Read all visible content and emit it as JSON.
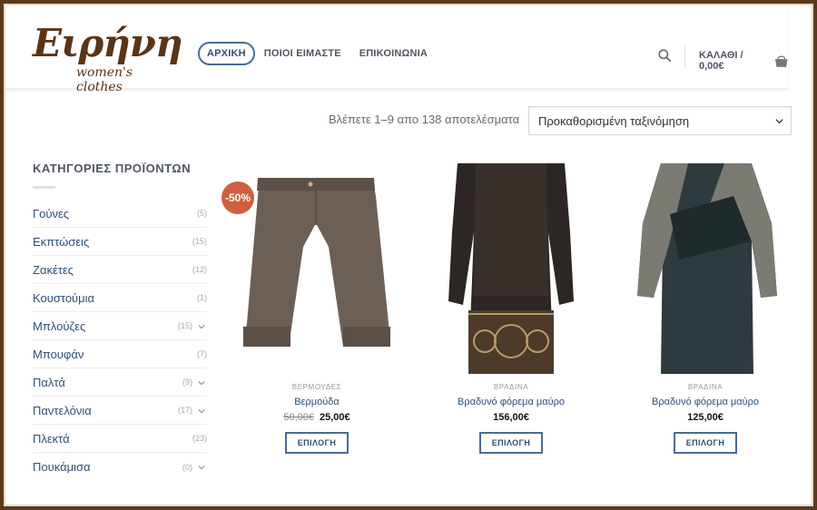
{
  "brand": {
    "name": "Ειρήνη",
    "tagline": "women's clothes"
  },
  "nav": {
    "items": [
      "ΑΡΧΙΚΗ",
      "ΠΟΙΟΙ ΕΙΜΑΣΤΕ",
      "ΕΠΙΚΟΙΝΩΝΙΑ"
    ],
    "active_index": 0
  },
  "cart": {
    "label": "ΚΑΛΑΘΙ / 0,00€"
  },
  "results": {
    "text": "Βλέπετε 1–9 απο 138 αποτελέσματα"
  },
  "sort": {
    "selected": "Προκαθορισμένη ταξινόμηση"
  },
  "sidebar": {
    "title": "ΚΑΤΗΓΟΡΙΕΣ ΠΡΟΪΟΝΤΩΝ",
    "categories": [
      {
        "name": "Γούνες",
        "count": "(5)",
        "expandable": false
      },
      {
        "name": "Εκπτώσεις",
        "count": "(15)",
        "expandable": false
      },
      {
        "name": "Ζακέτες",
        "count": "(12)",
        "expandable": false
      },
      {
        "name": "Κουστούμια",
        "count": "(1)",
        "expandable": false
      },
      {
        "name": "Μπλούζες",
        "count": "(15)",
        "expandable": true
      },
      {
        "name": "Μπουφάν",
        "count": "(7)",
        "expandable": false
      },
      {
        "name": "Παλτά",
        "count": "(9)",
        "expandable": true
      },
      {
        "name": "Παντελόνια",
        "count": "(17)",
        "expandable": true
      },
      {
        "name": "Πλεκτά",
        "count": "(23)",
        "expandable": false
      },
      {
        "name": "Πουκάμισα",
        "count": "(0)",
        "expandable": true
      }
    ]
  },
  "products": [
    {
      "category": "ΒΕΡΜΟΥΔΕΣ",
      "name": "Βερμούδα",
      "old_price": "50,00€",
      "price": "25,00€",
      "badge": "-50%",
      "button": "ΕΠΙΛΟΓΗ"
    },
    {
      "category": "ΒΡΑΔΙΝΑ",
      "name": "Βραδυνό φόρεμα μαύρο",
      "old_price": "",
      "price": "156,00€",
      "badge": "",
      "button": "ΕΠΙΛΟΓΗ"
    },
    {
      "category": "ΒΡΑΔΙΝΑ",
      "name": "Βραδυνό φόρεμα μαύρο",
      "old_price": "",
      "price": "125,00€",
      "badge": "",
      "button": "ΕΠΙΛΟΓΗ"
    }
  ],
  "colors": {
    "brand_brown": "#5b3416",
    "link_blue": "#2f4f77",
    "sale_badge": "#cf5f3f",
    "frame": "#5a3a1e"
  },
  "icons": {
    "search": "search-icon",
    "cart": "cart-icon",
    "sort": "chevron-down-icon",
    "toggle": "chevron-down-icon"
  }
}
